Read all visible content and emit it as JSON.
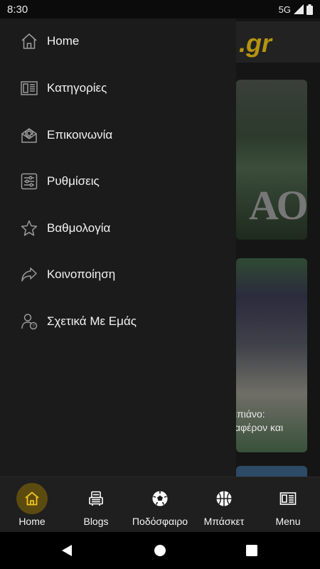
{
  "status_bar": {
    "time": "8:30",
    "network": "5G"
  },
  "background": {
    "logo_text": ".gr",
    "card1_text": "ΑΟ",
    "card2_line1": "ιπιάνο:",
    "card2_line2": "αφέρον και"
  },
  "drawer": {
    "items": [
      {
        "label": "Home",
        "icon": "home-icon"
      },
      {
        "label": "Κατηγορίες",
        "icon": "categories-icon"
      },
      {
        "label": "Επικοινωνία",
        "icon": "contact-icon"
      },
      {
        "label": "Ρυθμίσεις",
        "icon": "settings-icon"
      },
      {
        "label": "Βαθμολογία",
        "icon": "star-icon"
      },
      {
        "label": "Κοινοποίηση",
        "icon": "share-icon"
      },
      {
        "label": "Σχετικά Με Εμάς",
        "icon": "about-icon"
      }
    ]
  },
  "bottom_nav": {
    "items": [
      {
        "label": "Home",
        "icon": "home-icon",
        "active": true
      },
      {
        "label": "Blogs",
        "icon": "blogs-icon",
        "active": false
      },
      {
        "label": "Ποδόσφαιρο",
        "icon": "football-icon",
        "active": false
      },
      {
        "label": "Μπάσκετ",
        "icon": "basketball-icon",
        "active": false
      },
      {
        "label": "Menu",
        "icon": "menu-icon",
        "active": false
      }
    ]
  },
  "colors": {
    "accent": "#f0c419",
    "active_bg": "#5c4b10",
    "drawer_bg": "#1b1b1b",
    "icon_gray": "#9a9a9a"
  }
}
